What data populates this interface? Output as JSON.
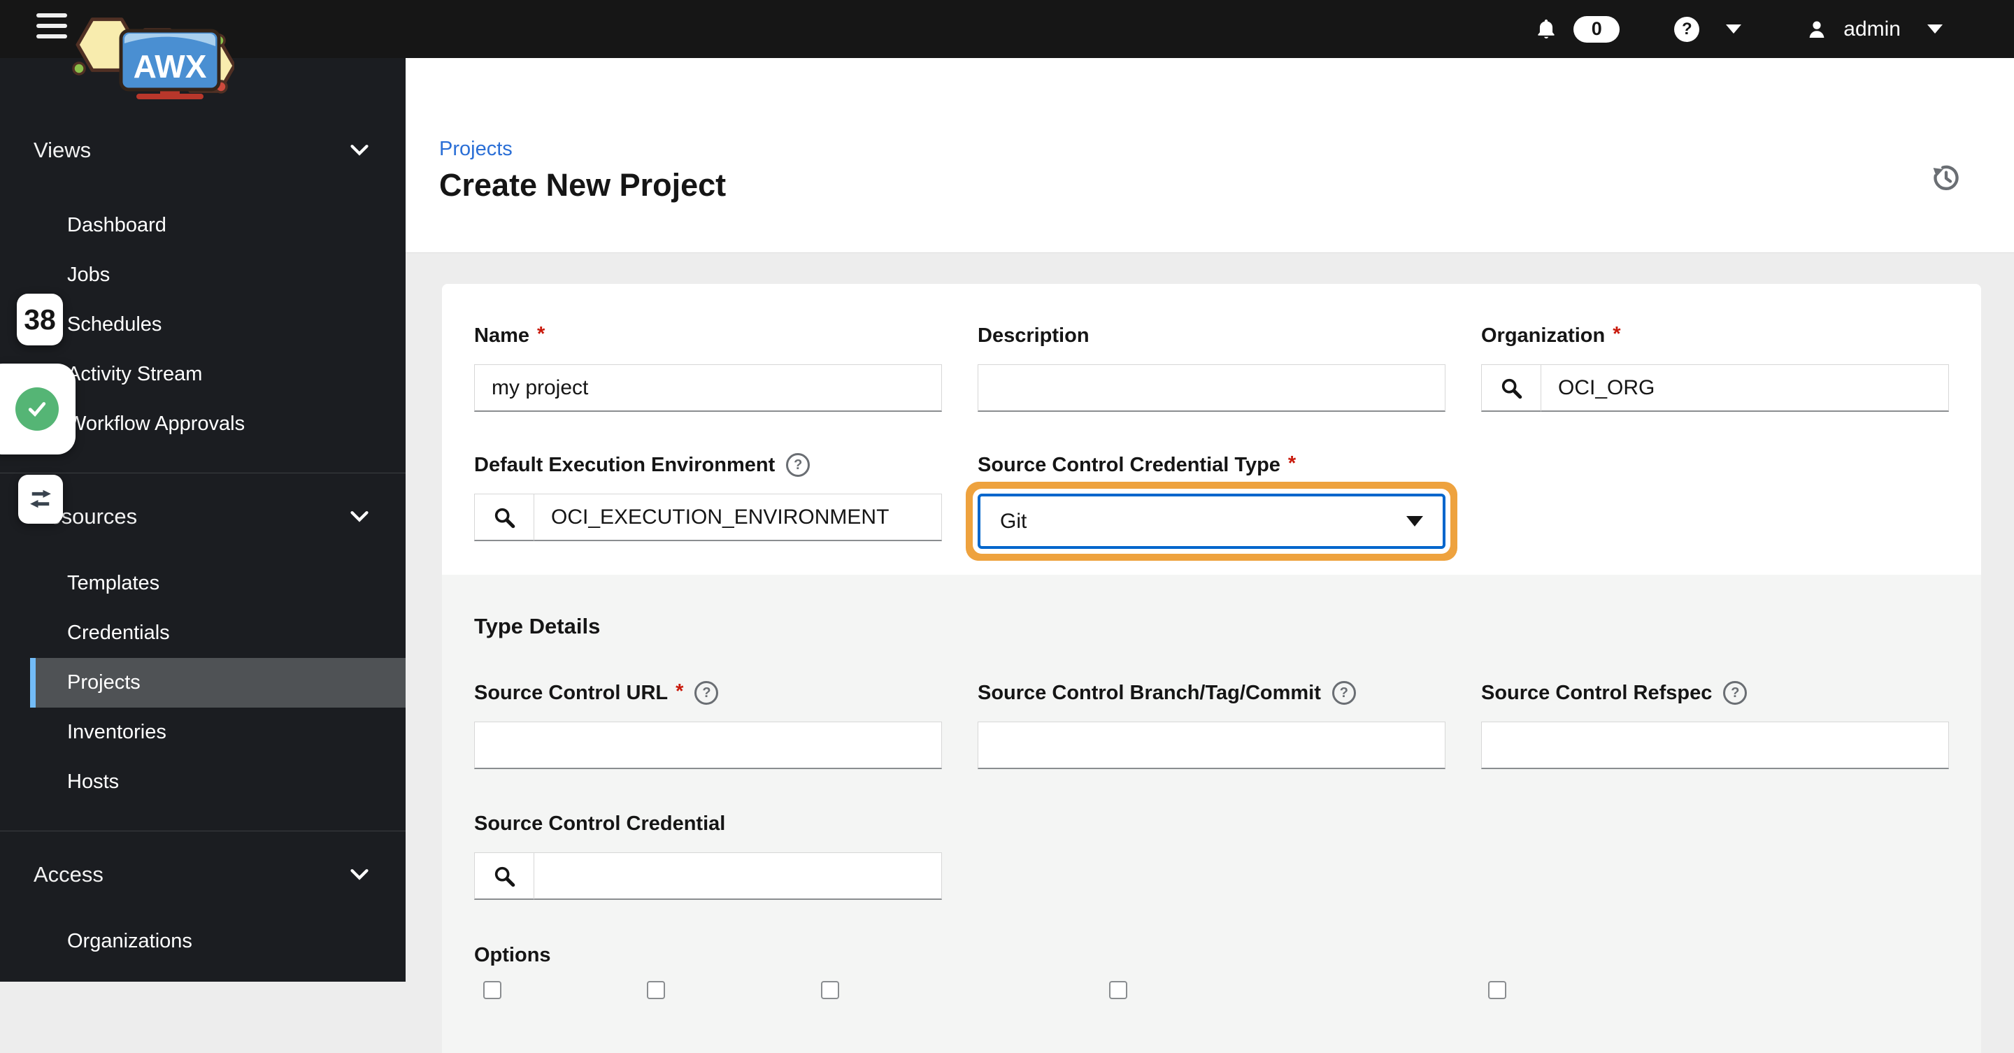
{
  "topbar": {
    "product": "AWX",
    "notifications_count": "0",
    "help_glyph": "?",
    "username": "admin"
  },
  "sidebar": {
    "groups": [
      {
        "label": "Views",
        "items": [
          {
            "label": "Dashboard"
          },
          {
            "label": "Jobs"
          },
          {
            "label": "Schedules"
          },
          {
            "label": "Activity Stream"
          },
          {
            "label": "Workflow Approvals"
          }
        ]
      },
      {
        "label": "Resources",
        "items": [
          {
            "label": "Templates"
          },
          {
            "label": "Credentials"
          },
          {
            "label": "Projects"
          },
          {
            "label": "Inventories"
          },
          {
            "label": "Hosts"
          }
        ]
      },
      {
        "label": "Access",
        "items": [
          {
            "label": "Organizations"
          }
        ]
      }
    ],
    "selected_item": "Projects",
    "overlay_badge_count": "38"
  },
  "page": {
    "breadcrumb": "Projects",
    "title": "Create New Project"
  },
  "form": {
    "name": {
      "label": "Name",
      "required_marker": "*",
      "value": "my project"
    },
    "description": {
      "label": "Description",
      "value": ""
    },
    "organization": {
      "label": "Organization",
      "required_marker": "*",
      "value": "OCI_ORG"
    },
    "default_execution_environment": {
      "label": "Default Execution Environment",
      "help_glyph": "?",
      "value": "OCI_EXECUTION_ENVIRONMENT"
    },
    "scm_credential_type": {
      "label": "Source Control Credential Type",
      "required_marker": "*",
      "value": "Git"
    },
    "type_details_heading": "Type Details",
    "scm_url": {
      "label": "Source Control URL",
      "required_marker": "*",
      "help_glyph": "?",
      "value": ""
    },
    "scm_branch": {
      "label": "Source Control Branch/Tag/Commit",
      "help_glyph": "?",
      "value": ""
    },
    "scm_refspec": {
      "label": "Source Control Refspec",
      "help_glyph": "?",
      "value": ""
    },
    "scm_credential": {
      "label": "Source Control Credential",
      "value": ""
    },
    "options_label": "Options"
  },
  "colors": {
    "highlight_ring": "#eea23e",
    "focus_border": "#0066cc",
    "selected_accent": "#73bcf7",
    "link": "#2b6fd6",
    "required_red": "#c9190b"
  }
}
